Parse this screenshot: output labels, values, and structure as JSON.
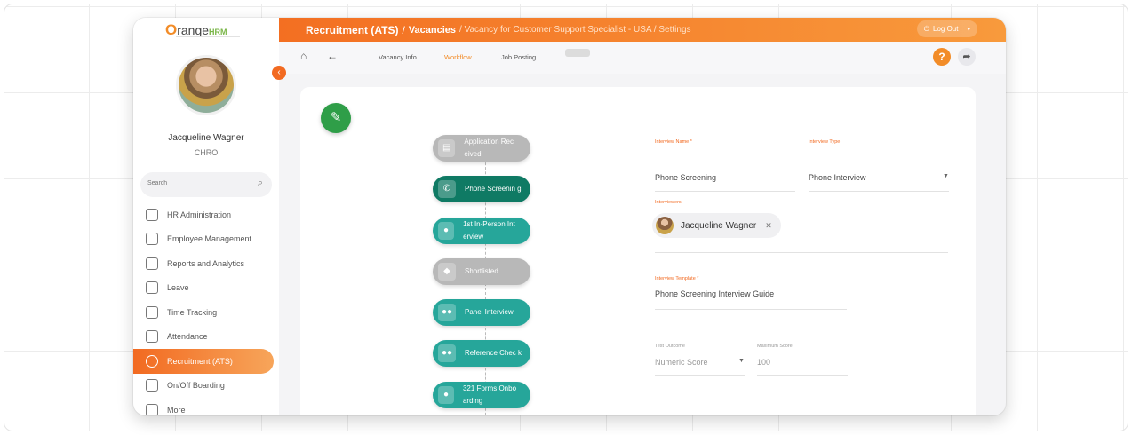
{
  "app": {
    "logo_prefix": "O",
    "logo_main": "range",
    "logo_suffix": "HRM"
  },
  "user": {
    "name": "Jacqueline Wagner",
    "role": "CHRO"
  },
  "sidebar": {
    "search_placeholder": "Search",
    "items": [
      {
        "label": "HR Administration",
        "icon": "hr-admin-icon"
      },
      {
        "label": "Employee Management",
        "icon": "employee-management-icon"
      },
      {
        "label": "Reports and Analytics",
        "icon": "reports-icon"
      },
      {
        "label": "Leave",
        "icon": "leave-icon"
      },
      {
        "label": "Time Tracking",
        "icon": "time-tracking-icon"
      },
      {
        "label": "Attendance",
        "icon": "attendance-icon"
      },
      {
        "label": "Recruitment (ATS)",
        "icon": "recruitment-icon",
        "active": true
      },
      {
        "label": "On/Off Boarding",
        "icon": "onboarding-icon"
      },
      {
        "label": "More",
        "icon": "more-icon"
      }
    ]
  },
  "header": {
    "breadcrumb_main": "Recruitment (ATS)",
    "breadcrumb_sep": "/",
    "breadcrumb_sub": "Vacancies",
    "breadcrumb_rest": "/ Vacancy for Customer Support Specialist - USA / Settings",
    "logout_label": "Log Out"
  },
  "subnav": {
    "tabs": [
      "Vacancy Info",
      "Workflow",
      "Job Posting"
    ],
    "active_tab": "Workflow",
    "help_label": "?"
  },
  "workflow": {
    "steps": [
      {
        "label": "Application Rec eived",
        "icon": "document-icon",
        "state": "inactive"
      },
      {
        "label": "Phone Screenin g",
        "icon": "phone-icon",
        "state": "selected"
      },
      {
        "label": "1st In-Person Int erview",
        "icon": "person-icon",
        "state": "active"
      },
      {
        "label": "Shortlisted",
        "icon": "tag-icon",
        "state": "inactive"
      },
      {
        "label": "Panel Interview",
        "icon": "group-icon",
        "state": "active"
      },
      {
        "label": "Reference Chec k",
        "icon": "group-icon",
        "state": "active"
      },
      {
        "label": "321 Forms Onbo arding",
        "icon": "person-icon",
        "state": "active"
      }
    ]
  },
  "form": {
    "interview_name_label": "Interview Name *",
    "interview_name_value": "Phone Screening",
    "interview_type_label": "Interview Type",
    "interview_type_value": "Phone Interview",
    "interviewers_label": "Interviewers",
    "interviewer_chip": "Jacqueline Wagner",
    "interview_template_label": "Interview Template *",
    "interview_template_value": "Phone Screening Interview Guide",
    "test_outcome_label": "Test Outcome",
    "test_outcome_value": "Numeric Score",
    "max_score_label": "Maximum Score",
    "max_score_value": "100"
  },
  "colors": {
    "accent": "#f26a21",
    "brand_green": "#2f9e48",
    "step_teal": "#26a69a",
    "step_selected": "#0f7a64",
    "step_inactive": "#b8b8b8"
  }
}
